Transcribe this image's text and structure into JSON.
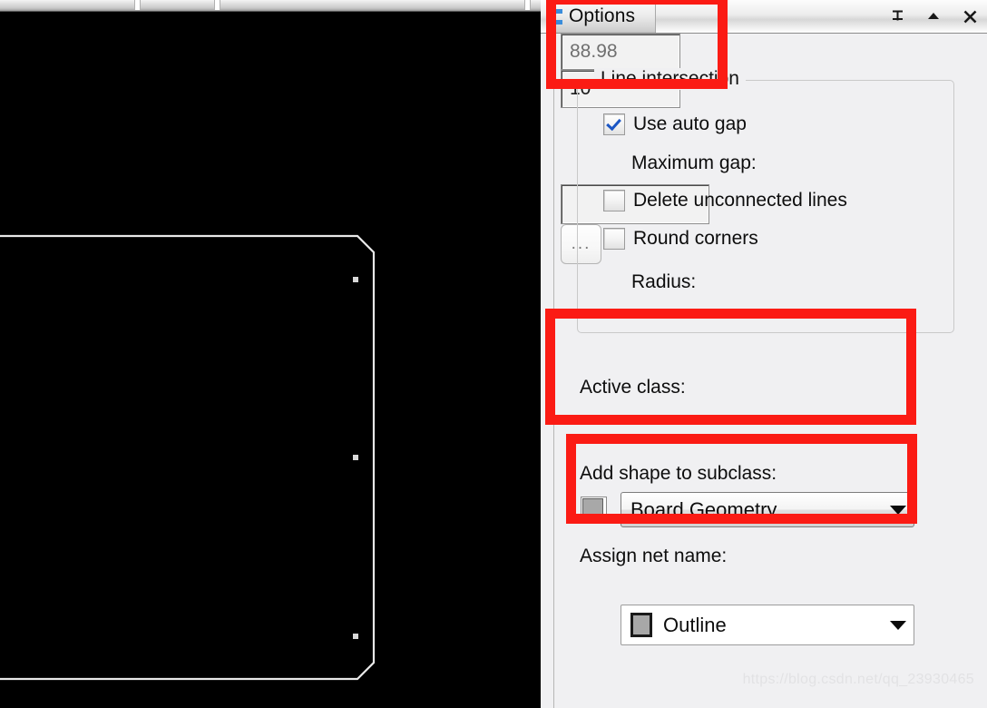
{
  "panel": {
    "tab_label": "Options",
    "grip_icon": "grip-dots-icon",
    "buttons": [
      {
        "name": "pin-icon",
        "glyph": "中"
      },
      {
        "name": "collapse-up-icon",
        "glyph": "▲"
      },
      {
        "name": "close-icon",
        "glyph": "✕"
      }
    ]
  },
  "line_intersection": {
    "group_title": "Line intersection",
    "use_auto_gap": {
      "label": "Use auto gap",
      "checked": true
    },
    "maximum_gap": {
      "label": "Maximum gap:",
      "value": "88.98"
    },
    "delete_unconnected_lines": {
      "label": "Delete unconnected lines",
      "checked": false
    },
    "round_corners": {
      "label": "Round corners",
      "checked": false
    },
    "radius": {
      "label": "Radius:",
      "value": "10"
    }
  },
  "active_class": {
    "label": "Active class:",
    "value": "Board Geometry"
  },
  "add_shape_to_subclass": {
    "label": "Add shape to subclass:",
    "value": "Outline",
    "swatch_color": "#a8a8a8"
  },
  "assign_net_name": {
    "label": "Assign net name:",
    "value": "",
    "browse_button": "..."
  },
  "annotations": {
    "accent_color": "#fb1b14",
    "boxes": [
      {
        "name": "annotation-options-tab",
        "target": "Options / Line intersection"
      },
      {
        "name": "annotation-active-class",
        "target": "Active class"
      },
      {
        "name": "annotation-add-shape-subclass",
        "target": "Add shape to subclass"
      }
    ]
  },
  "canvas": {
    "background": "#000000",
    "outline_color": "#e8e8e8",
    "vertex_marker_color": "#d8d8d8"
  },
  "watermark": "https://blog.csdn.net/qq_23930465"
}
